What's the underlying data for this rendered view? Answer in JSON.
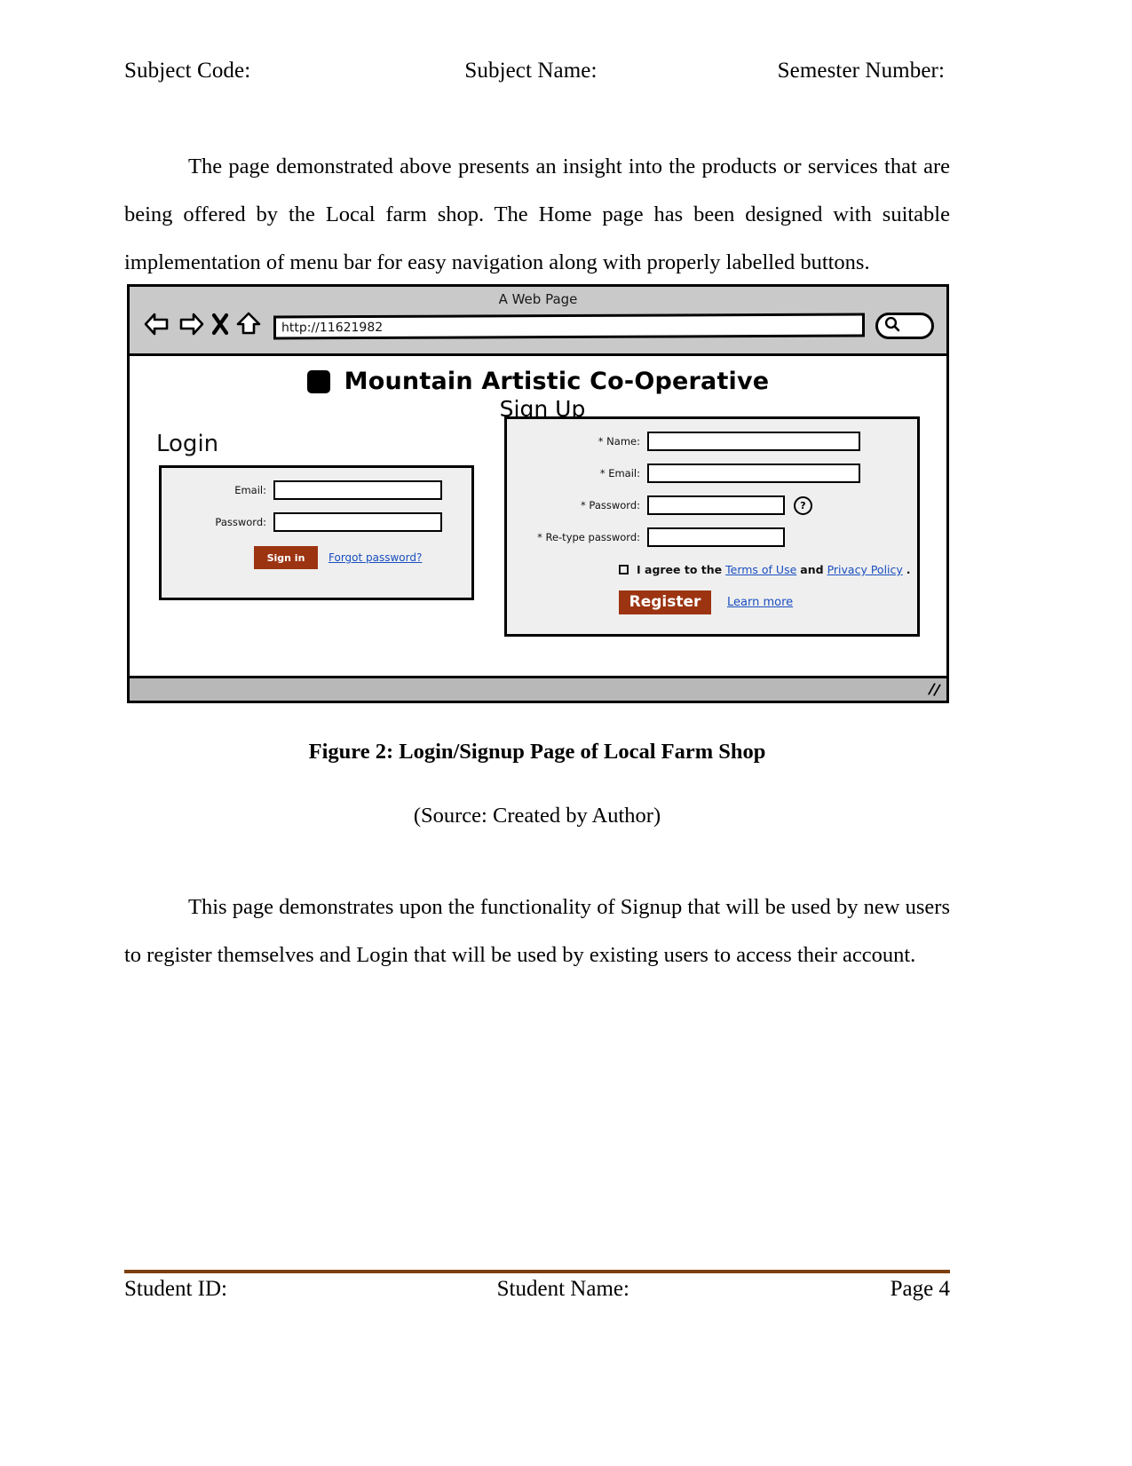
{
  "header": {
    "subject_code": "Subject Code:",
    "subject_name": "Subject Name:",
    "semester_number": "Semester Number:"
  },
  "body": {
    "paragraph_1": "The page demonstrated above presents an insight into the products or services that are being offered by the Local farm shop. The Home page has been designed with suitable implementation of menu bar for easy navigation along with properly labelled buttons.",
    "paragraph_2": "This page demonstrates upon the functionality of Signup that will be used by new users to register themselves and Login that will be used by existing users to access their account."
  },
  "figure": {
    "caption": "Figure 2: Login/Signup Page of Local Farm Shop",
    "source": "(Source: Created by Author)",
    "browser": {
      "window_title": "A Web Page",
      "url_value": "http://11621982",
      "back_icon": "back-arrow-icon",
      "forward_icon": "forward-arrow-icon",
      "stop_icon": "close-x-icon",
      "home_icon": "home-icon",
      "search_icon": "search-icon"
    },
    "site": {
      "brand": "Mountain Artistic Co-Operative",
      "page_heading": "Sign Up",
      "login": {
        "heading": "Login",
        "email_label": "Email:",
        "password_label": "Password:",
        "email_value": "",
        "password_value": "",
        "signin_label": "Sign in",
        "forgot_label": "Forgot password?"
      },
      "signup": {
        "name_label": "* Name:",
        "email_label": "* Email:",
        "password_label": "* Password:",
        "retype_label": "* Re-type password:",
        "name_value": "",
        "email_value": "",
        "password_value": "",
        "retype_value": "",
        "help_icon_glyph": "?",
        "agree_prefix": "I agree to the",
        "terms_link": "Terms of Use",
        "agree_middle": "and",
        "privacy_link": "Privacy Policy",
        "agree_suffix": ".",
        "register_label": "Register",
        "learn_more_label": "Learn more"
      }
    }
  },
  "footer": {
    "student_id": "Student ID:",
    "student_name": "Student Name:",
    "page_number": "Page 4"
  },
  "colors": {
    "accent_button": "#9c3412",
    "footer_rule": "#7b3f10",
    "link": "#1a4fbf",
    "chrome_gray": "#c9c9c9",
    "panel_gray": "#efefef"
  }
}
